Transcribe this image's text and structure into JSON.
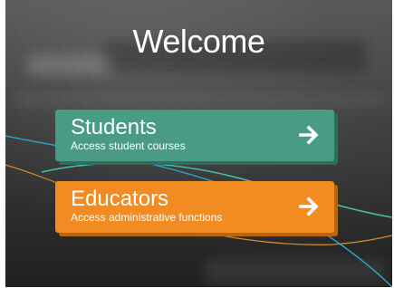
{
  "page": {
    "title": "Welcome"
  },
  "options": [
    {
      "name": "Students",
      "description": "Access student courses",
      "icon": "arrow-right-icon",
      "color": "#4a9b86"
    },
    {
      "name": "Educators",
      "description": "Access administrative functions",
      "icon": "arrow-right-icon",
      "color": "#f28b21"
    }
  ]
}
